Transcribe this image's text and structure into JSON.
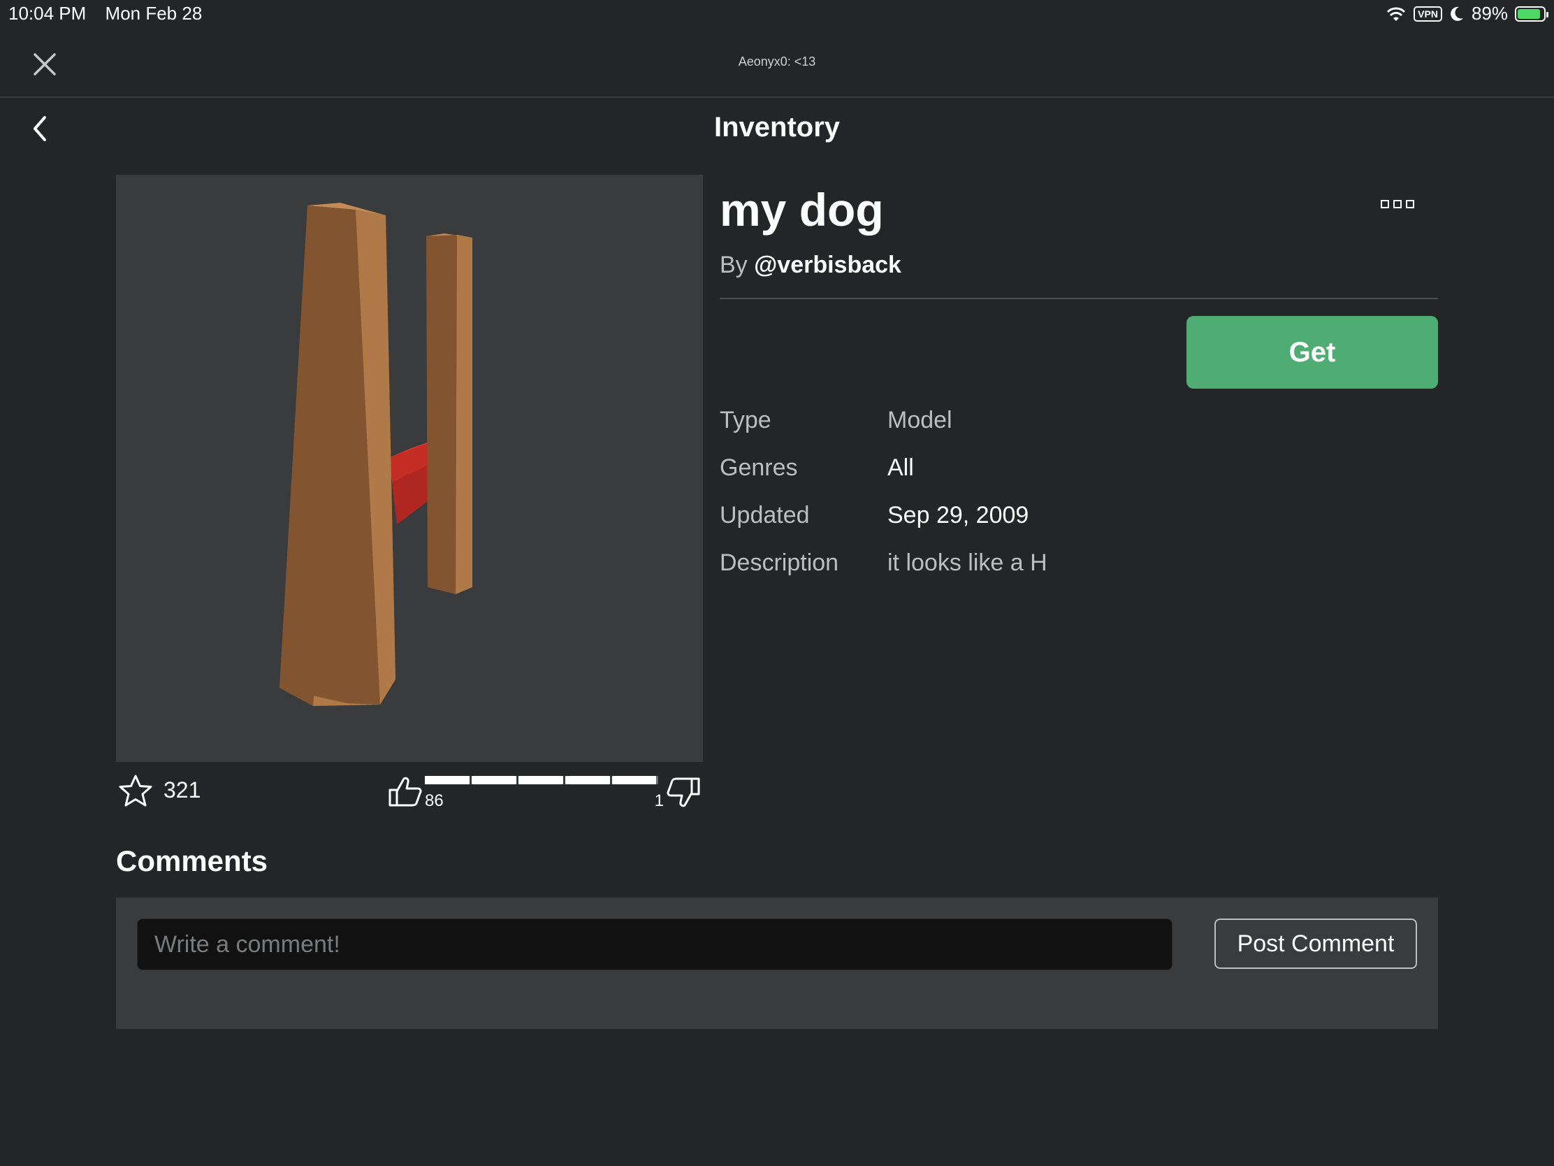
{
  "status_bar": {
    "time": "10:04 PM",
    "date": "Mon Feb 28",
    "vpn_label": "VPN",
    "battery_percent": "89%",
    "battery_level": 0.89
  },
  "header": {
    "session_title": "Aeonyx0: <13"
  },
  "nav": {
    "title": "Inventory"
  },
  "item": {
    "name": "my dog",
    "by_label": "By",
    "creator": "@verbisback",
    "get_label": "Get",
    "favorites": "321",
    "upvotes": "86",
    "downvotes": "1",
    "upvote_ratio": 0.99
  },
  "details": {
    "type_label": "Type",
    "type_value": "Model",
    "genres_label": "Genres",
    "genres_value": "All",
    "updated_label": "Updated",
    "updated_value": "Sep 29, 2009",
    "description_label": "Description",
    "description_value": "it looks like a H"
  },
  "comments": {
    "title": "Comments",
    "placeholder": "Write a comment!",
    "post_label": "Post Comment"
  },
  "colors": {
    "background": "#232527",
    "panel": "#393b3d",
    "accent_green": "#4fad74",
    "wood": "#b07a48",
    "wood_dark": "#825530",
    "red_part": "#e0362c"
  },
  "icons": {
    "close": "close-icon",
    "back": "chevron-left-icon",
    "more": "more-icon",
    "favorite": "star-icon",
    "upvote": "thumbs-up-icon",
    "downvote": "thumbs-down-icon"
  }
}
